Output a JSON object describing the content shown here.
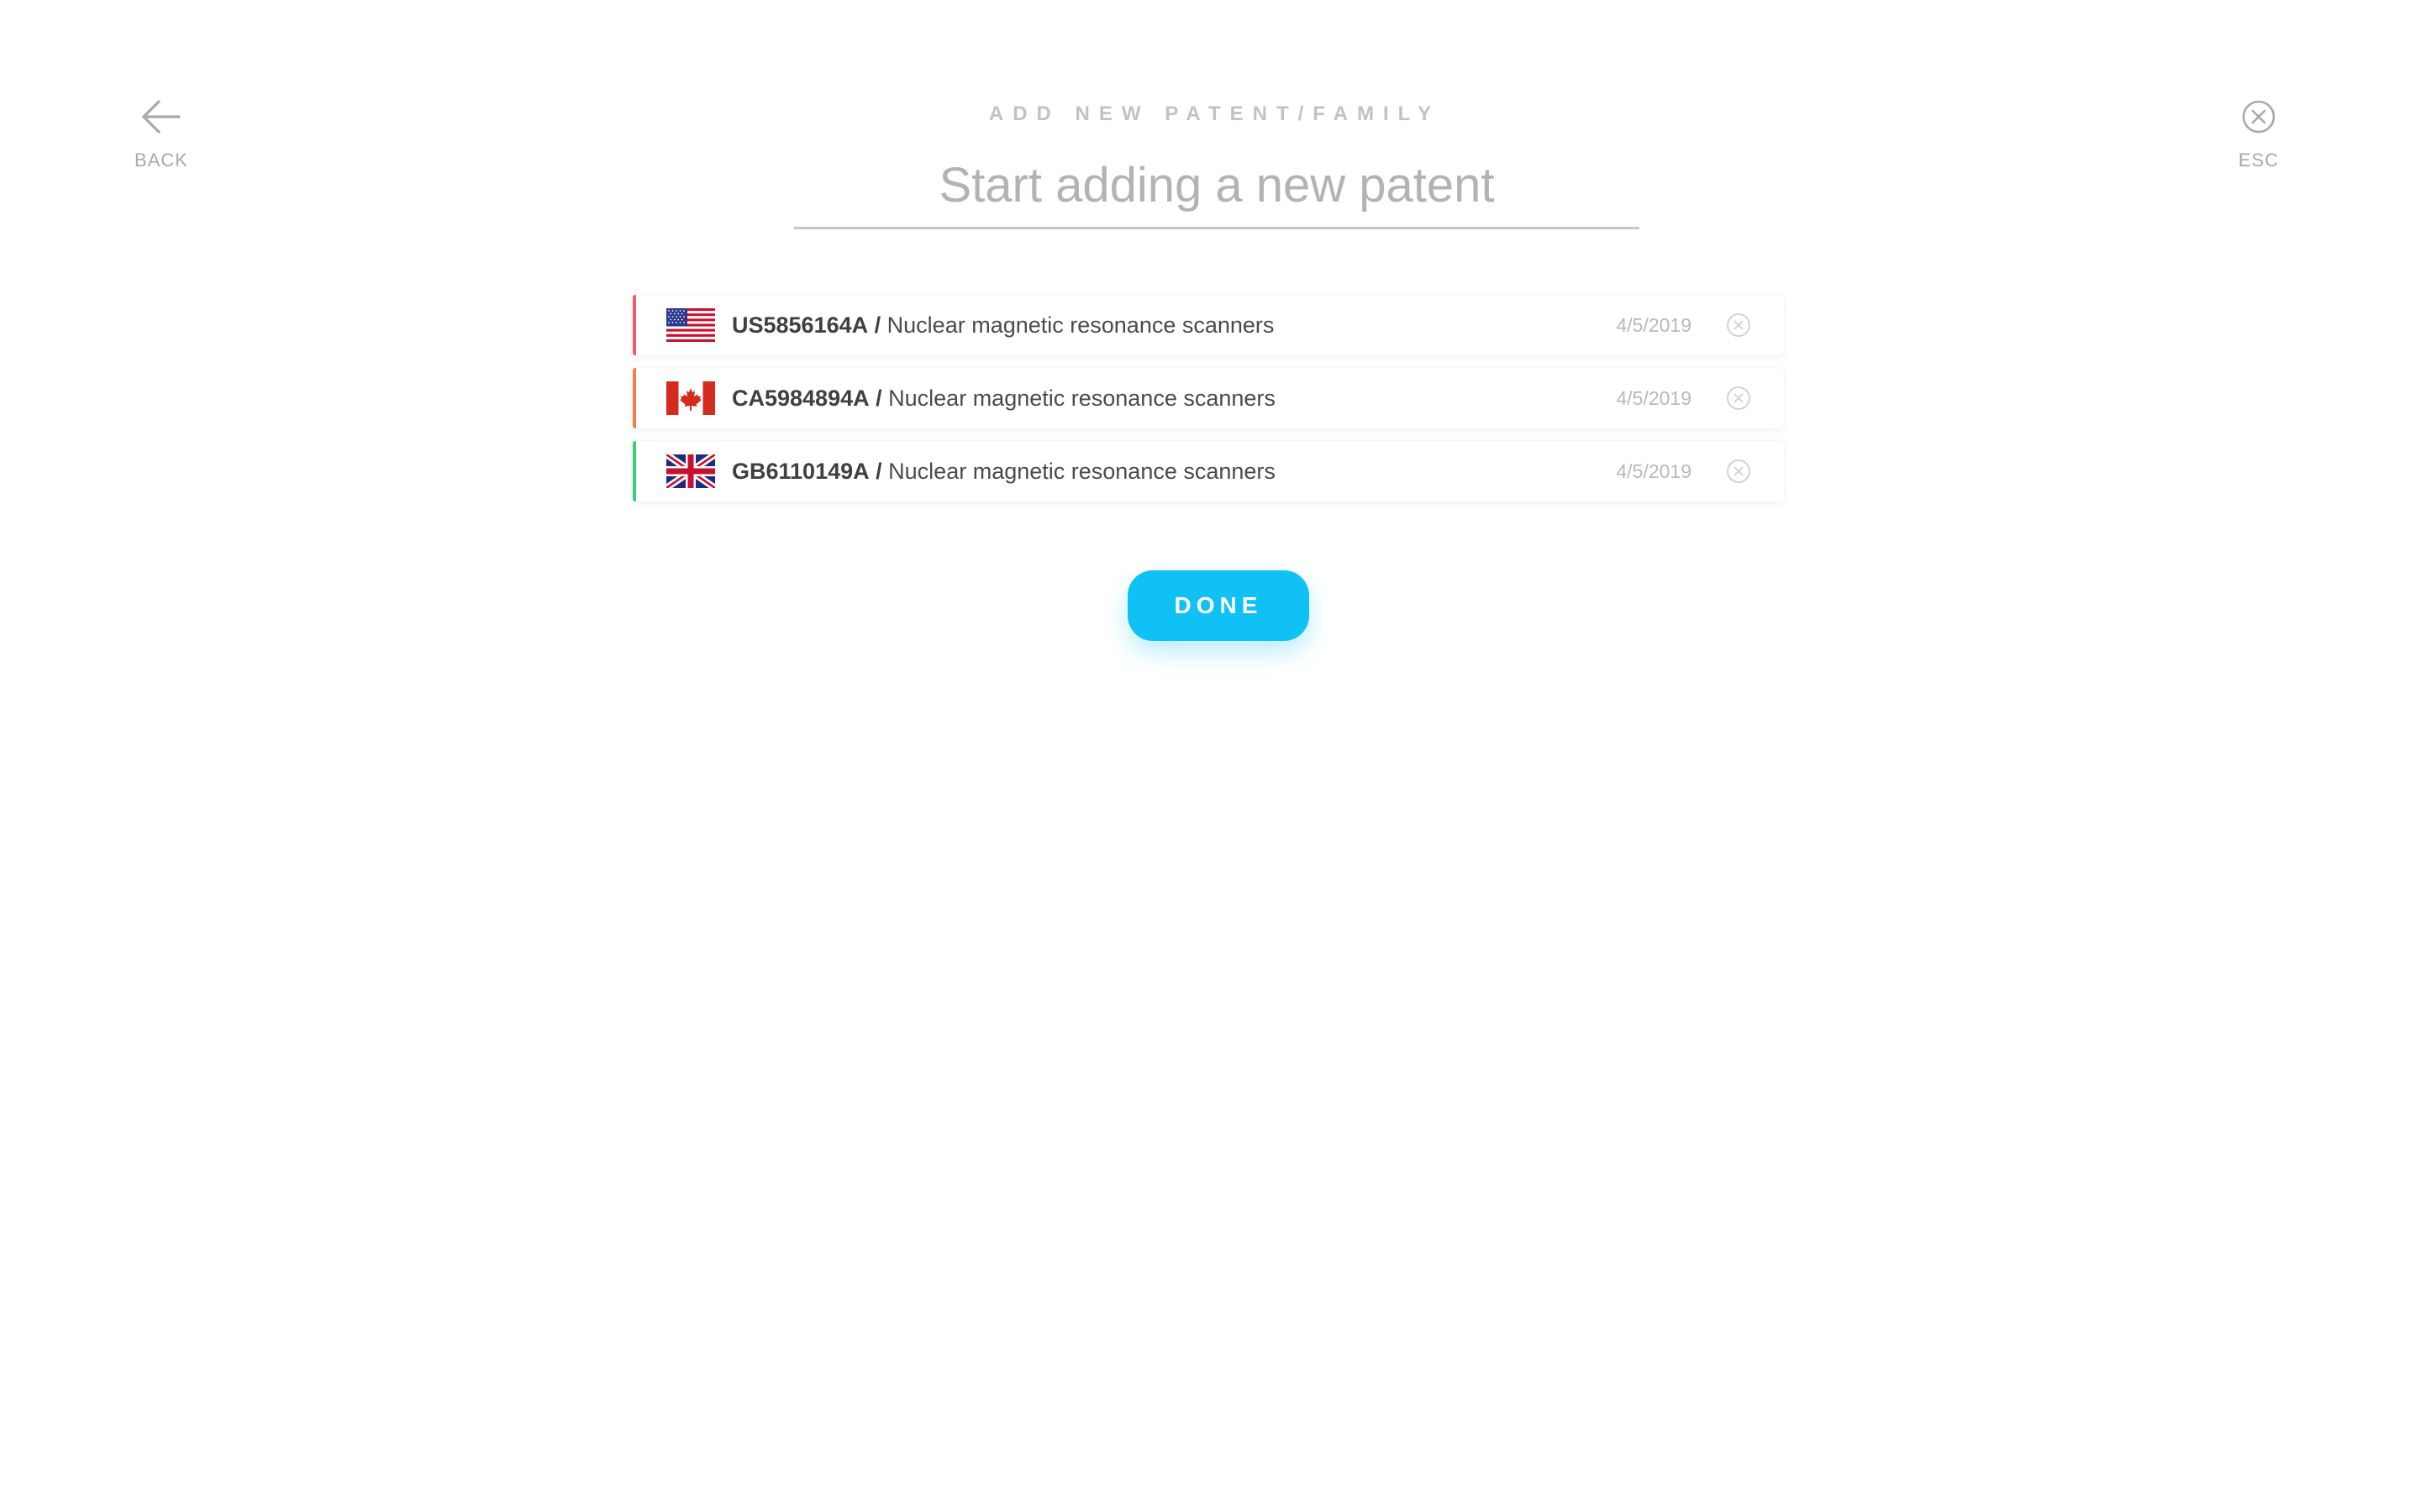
{
  "nav": {
    "back_label": "BACK",
    "esc_label": "ESC"
  },
  "header": {
    "eyebrow": "ADD NEW PATENT/FAMILY",
    "search_placeholder": "Start adding a new patent",
    "search_value": ""
  },
  "patents": [
    {
      "country": "US",
      "flag_icon": "us-flag-icon",
      "accent_color": "#f25a6e",
      "id": "US5856164A",
      "separator": "/",
      "title": "Nuclear magnetic resonance scanners",
      "date": "4/5/2019"
    },
    {
      "country": "CA",
      "flag_icon": "canada-flag-icon",
      "accent_color": "#f57d4a",
      "id": "CA5984894A",
      "separator": "/",
      "title": "Nuclear magnetic resonance scanners",
      "date": "4/5/2019"
    },
    {
      "country": "GB",
      "flag_icon": "uk-flag-icon",
      "accent_color": "#2fd37a",
      "id": "GB6110149A",
      "separator": "/",
      "title": "Nuclear magnetic resonance scanners",
      "date": "4/5/2019"
    }
  ],
  "actions": {
    "done_label": "DONE"
  },
  "colors": {
    "primary": "#0fc1f4",
    "muted_text": "#a9a9ad"
  }
}
